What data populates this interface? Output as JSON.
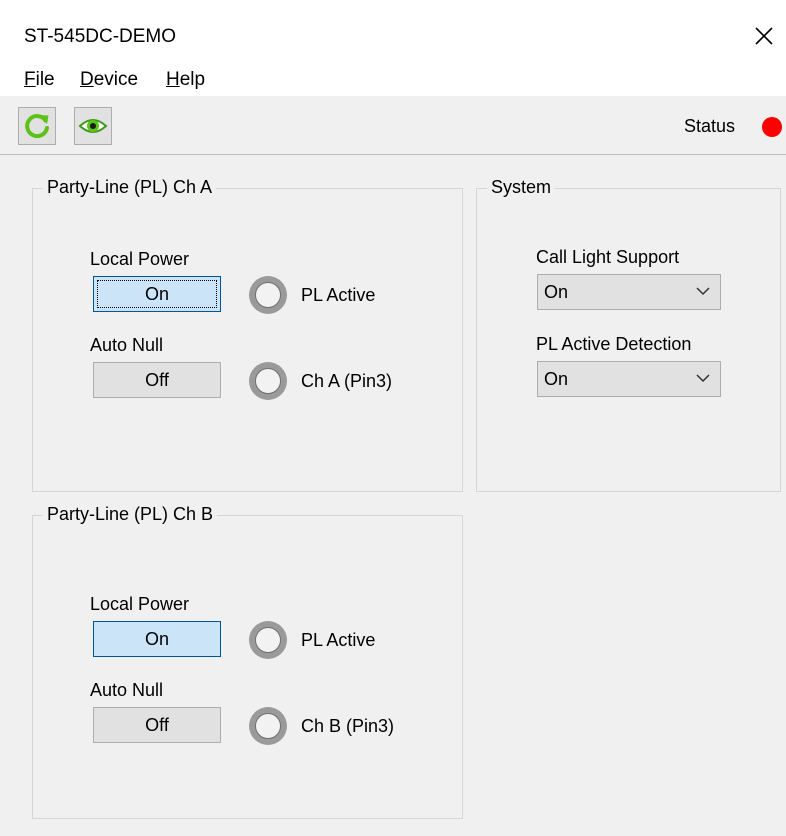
{
  "window": {
    "title": "ST-545DC-DEMO"
  },
  "menu": {
    "file": {
      "mnemonic": "F",
      "rest": "ile"
    },
    "device": {
      "mnemonic": "D",
      "rest": "evice"
    },
    "help": {
      "mnemonic": "H",
      "rest": "elp"
    }
  },
  "toolbar": {
    "refresh_icon": "refresh-icon",
    "view_icon": "eye-icon",
    "status_label": "Status",
    "status_color": "#ff0000"
  },
  "ch_a": {
    "title": "Party-Line (PL) Ch A",
    "local_power_label": "Local Power",
    "local_power_value": "On",
    "auto_null_label": "Auto Null",
    "auto_null_value": "Off",
    "led1_label": "PL Active",
    "led2_label": "Ch A (Pin3)"
  },
  "ch_b": {
    "title": "Party-Line (PL) Ch B",
    "local_power_label": "Local Power",
    "local_power_value": "On",
    "auto_null_label": "Auto Null",
    "auto_null_value": "Off",
    "led1_label": "PL Active",
    "led2_label": "Ch B (Pin3)"
  },
  "system": {
    "title": "System",
    "call_light_label": "Call Light Support",
    "call_light_value": "On",
    "pl_detect_label": "PL Active Detection",
    "pl_detect_value": "On"
  }
}
